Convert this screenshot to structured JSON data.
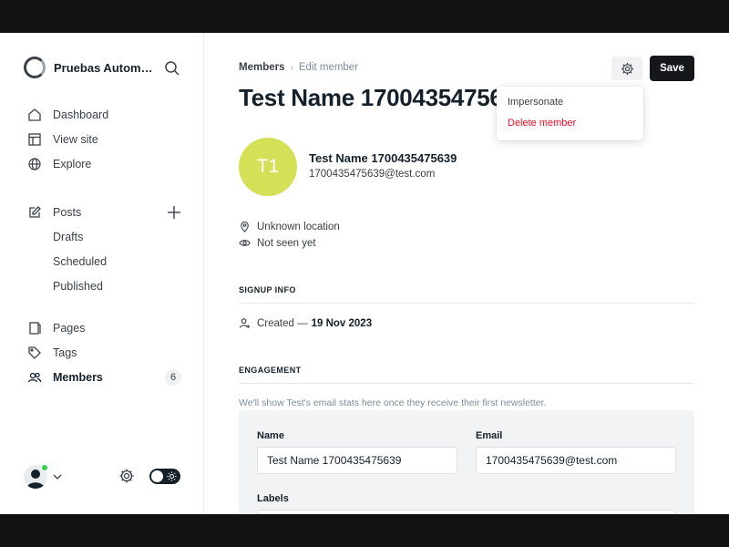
{
  "sidebar": {
    "site_name": "Pruebas Automa...",
    "nav": {
      "dashboard": "Dashboard",
      "view_site": "View site",
      "explore": "Explore",
      "posts": "Posts",
      "drafts": "Drafts",
      "scheduled": "Scheduled",
      "published": "Published",
      "pages": "Pages",
      "tags": "Tags",
      "members": "Members",
      "members_count": "6"
    }
  },
  "header": {
    "breadcrumb_parent": "Members",
    "breadcrumb_current": "Edit member",
    "title": "Test Name 1700435475639",
    "save_label": "Save"
  },
  "dropdown": {
    "impersonate": "Impersonate",
    "delete": "Delete member"
  },
  "member": {
    "initials": "T1",
    "name": "Test Name 1700435475639",
    "email": "1700435475639@test.com",
    "location": "Unknown location",
    "last_seen": "Not seen yet"
  },
  "signup": {
    "heading": "SIGNUP INFO",
    "created_prefix": "Created —",
    "created_date": "19 Nov 2023"
  },
  "engagement": {
    "heading": "ENGAGEMENT",
    "note": "We'll show Test's email stats here once they receive their first newsletter."
  },
  "form": {
    "name_label": "Name",
    "name_value": "Test Name 1700435475639",
    "email_label": "Email",
    "email_value": "1700435475639@test.com",
    "labels_label": "Labels"
  },
  "colors": {
    "accent_avatar": "#d4e157",
    "danger": "#f50b23",
    "online": "#30cf43",
    "primary_button": "#15171a"
  }
}
